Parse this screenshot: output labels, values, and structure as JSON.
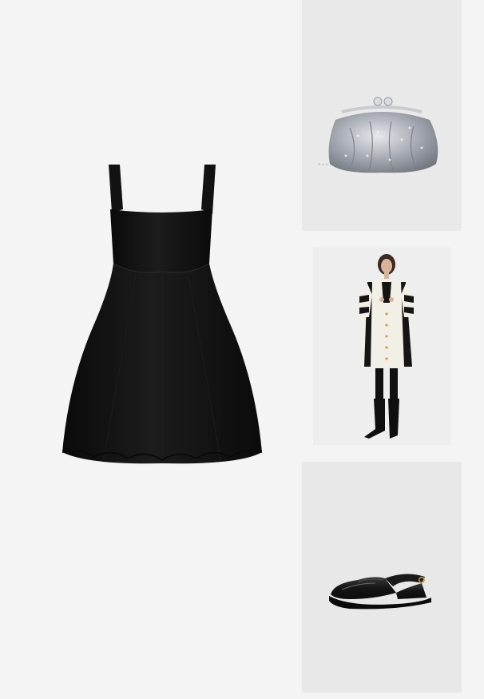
{
  "board": {
    "background": "#f4f4f4",
    "items": [
      {
        "name": "black-mini-dress",
        "icon": "dress-image"
      },
      {
        "name": "sequin-frame-clutch",
        "icon": "clutch-image"
      },
      {
        "name": "striped-cardigan-look",
        "icon": "model-image"
      },
      {
        "name": "black-slingback-loafer",
        "icon": "shoe-image"
      }
    ]
  },
  "colors": {
    "dress": "#111111",
    "clutch_silver": "#b9bcc3",
    "cardigan_cream": "#f2efe6",
    "shoe": "#151515"
  }
}
